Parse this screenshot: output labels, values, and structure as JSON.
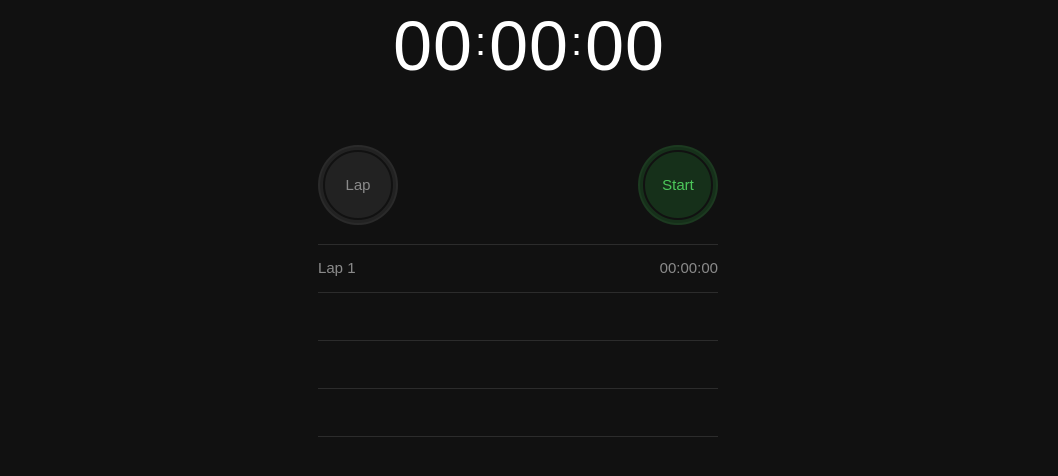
{
  "timer": {
    "hours": "00",
    "minutes": "00",
    "seconds": "00",
    "separator": ":"
  },
  "buttons": {
    "lap_label": "Lap",
    "start_label": "Start"
  },
  "colors": {
    "background": "#111111",
    "start_accent": "#4cc75a",
    "start_bg": "#16301a",
    "lap_bg": "#222222"
  },
  "laps": [
    {
      "label": "Lap 1",
      "time": "00:00:00"
    },
    {
      "label": "",
      "time": ""
    },
    {
      "label": "",
      "time": ""
    },
    {
      "label": "",
      "time": ""
    }
  ]
}
